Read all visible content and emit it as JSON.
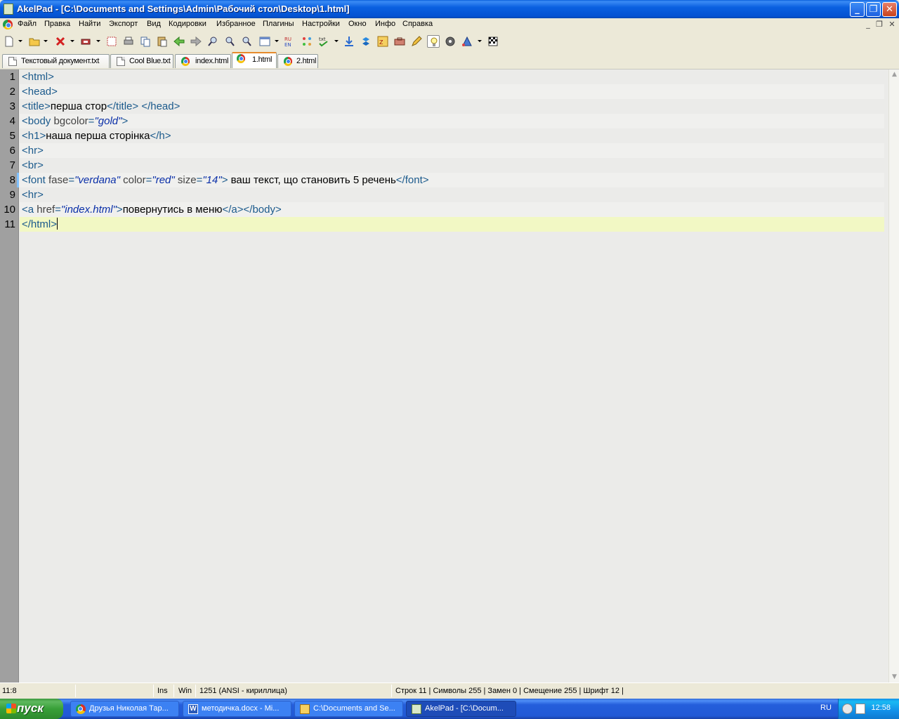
{
  "window": {
    "title": "AkelPad - [C:\\Documents and Settings\\Admin\\Рабочий стол\\Desktop\\1.html]",
    "minimize": "_",
    "restore": "❐",
    "close": "✕"
  },
  "menu": {
    "items": [
      "Файл",
      "Правка",
      "Найти",
      "Экспорт",
      "Вид",
      "Кодировки",
      "Избранное",
      "Плагины",
      "Настройки",
      "Окно",
      "Инфо",
      "Справка"
    ],
    "mdi_min": "_",
    "mdi_restore": "❐",
    "mdi_close": "✕"
  },
  "tabs": [
    {
      "label": "Текстовый документ.txt",
      "icon": "document-icon"
    },
    {
      "label": "Cool Blue.txt",
      "icon": "document-icon"
    },
    {
      "label": "index.html",
      "icon": "chrome-icon"
    },
    {
      "label": "1.html",
      "icon": "chrome-icon",
      "active": true
    },
    {
      "label": "2.html",
      "icon": "chrome-icon"
    }
  ],
  "editor": {
    "line_numbers": [
      "1",
      "2",
      "3",
      "4",
      "5",
      "6",
      "7",
      "8",
      "9",
      "10",
      "11"
    ],
    "lines": [
      [
        {
          "t": "<html>",
          "c": "tag"
        }
      ],
      [
        {
          "t": "<head>",
          "c": "tag"
        }
      ],
      [
        {
          "t": "<title>",
          "c": "tag"
        },
        {
          "t": "перша стор",
          "c": "txt"
        },
        {
          "t": "</title> </head>",
          "c": "tag"
        }
      ],
      [
        {
          "t": "<body ",
          "c": "tag"
        },
        {
          "t": "bgcolor",
          "c": "attr"
        },
        {
          "t": "=",
          "c": "tag"
        },
        {
          "t": "\"gold\"",
          "c": "val"
        },
        {
          "t": ">",
          "c": "tag"
        }
      ],
      [
        {
          "t": "<h1>",
          "c": "tag"
        },
        {
          "t": "наша перша сторінка",
          "c": "txt"
        },
        {
          "t": "</h>",
          "c": "tag"
        }
      ],
      [
        {
          "t": "<hr>",
          "c": "tag"
        }
      ],
      [
        {
          "t": "<br>",
          "c": "tag"
        }
      ],
      [
        {
          "t": "<font ",
          "c": "tag"
        },
        {
          "t": "fase",
          "c": "attr"
        },
        {
          "t": "=",
          "c": "tag"
        },
        {
          "t": "\"verdana\"",
          "c": "val"
        },
        {
          "t": " color",
          "c": "attr"
        },
        {
          "t": "=",
          "c": "tag"
        },
        {
          "t": "\"red\"",
          "c": "val"
        },
        {
          "t": " size",
          "c": "attr"
        },
        {
          "t": "=",
          "c": "tag"
        },
        {
          "t": "\"14\"",
          "c": "val"
        },
        {
          "t": ">",
          "c": "tag"
        },
        {
          "t": " ваш текст, що становить 5 речень",
          "c": "txt"
        },
        {
          "t": "</font>",
          "c": "tag"
        }
      ],
      [
        {
          "t": "<hr>",
          "c": "tag"
        }
      ],
      [
        {
          "t": "<a ",
          "c": "tag"
        },
        {
          "t": "href",
          "c": "attr"
        },
        {
          "t": "=",
          "c": "tag"
        },
        {
          "t": "\"index.html\"",
          "c": "val"
        },
        {
          "t": ">",
          "c": "tag"
        },
        {
          "t": "повернутись в меню",
          "c": "txt"
        },
        {
          "t": "</a></body>",
          "c": "tag"
        }
      ],
      [
        {
          "t": "</html>",
          "c": "tag"
        }
      ]
    ]
  },
  "status": {
    "position": "11:8",
    "insert_mode": "Ins",
    "newline": "Win",
    "encoding": "1251  (ANSI - кириллица)",
    "stats": "Строк 11 | Символы 255 | Замен 0 | Смещение 255 | Шрифт 12 |"
  },
  "taskbar": {
    "start_label": "пуск",
    "tasks": [
      {
        "label": "Друзья Николая Тар...",
        "icon": "chrome-icon"
      },
      {
        "label": "методичка.docx - Mi...",
        "icon": "word-icon"
      },
      {
        "label": "C:\\Documents and Se...",
        "icon": "folder-icon"
      },
      {
        "label": "AkelPad - [C:\\Docum...",
        "icon": "akelpad-icon",
        "active": true
      }
    ],
    "language": "RU",
    "clock": "12:58"
  },
  "colors": {
    "title_bar": "#0a60e0",
    "current_line": "#f2f8c4",
    "gutter": "#a0a0a0",
    "tag_color": "#1b5a8c",
    "value_color": "#0a2fa8"
  }
}
